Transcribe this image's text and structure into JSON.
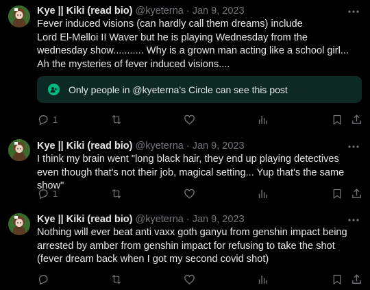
{
  "tweets": [
    {
      "name": "Kye || Kiki (read bio)",
      "handle": "@kyeterna",
      "sep": "·",
      "date": "Jan 9, 2023",
      "text": "Fever induced visions (can hardly call them dreams) include\nLord El-Melloi II Waver but he is playing Wednesday from the wednesday show........... Why is a grown man acting like a school girl... Ah the mysteries of fever induced visions....",
      "circle_notice": "Only people in @kyeterna’s Circle can see this post",
      "reply_count": "1"
    },
    {
      "name": "Kye || Kiki (read bio)",
      "handle": "@kyeterna",
      "sep": "·",
      "date": "Jan 9, 2023",
      "text": "I think my brain went \"long black hair, they end up playing detectives even though that's not their job, magical setting... Yup that's the same show\"",
      "reply_count": "1"
    },
    {
      "name": "Kye || Kiki (read bio)",
      "handle": "@kyeterna",
      "sep": "·",
      "date": "Jan 9, 2023",
      "text": "Nothing will ever beat anti vaxx goth ganyu from genshin impact being arrested by amber from genshin impact for refusing to take the shot (fever dream back when I got my second covid shot)",
      "reply_count": ""
    }
  ],
  "icons": {
    "more": "more-horizontal-icon",
    "reply": "reply-icon",
    "retweet": "retweet-icon",
    "like": "heart-icon",
    "views": "views-icon",
    "bookmark": "bookmark-icon",
    "share": "share-icon",
    "circle": "circle-people-icon"
  },
  "colors": {
    "background": "#000000",
    "text": "#e7e9ea",
    "muted": "#71767b",
    "circle_bg": "#0c2a23",
    "circle_icon": "#00ba7c"
  }
}
